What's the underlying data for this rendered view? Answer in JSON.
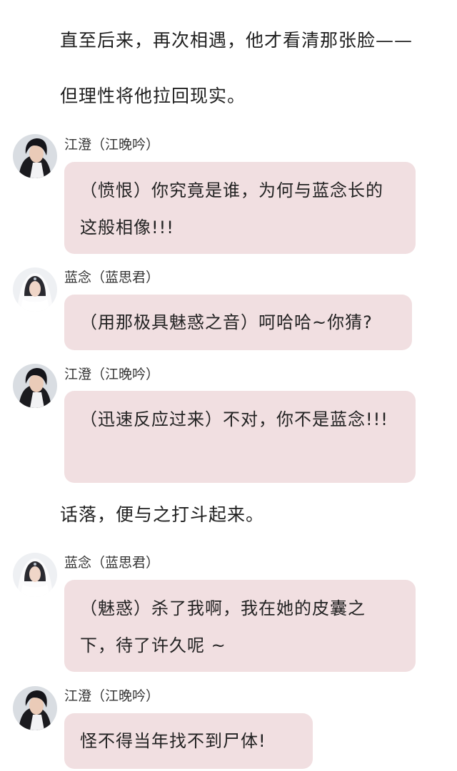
{
  "narration": [
    "直至后来，再次相遇，他才看清那张脸——",
    "但理性将他拉回现实。",
    "话落，便与之打斗起来。"
  ],
  "messages": [
    {
      "speaker": "江澄（江晚吟）",
      "avatar": "dark-haired-man-avatar",
      "text": "（愤恨）你究竟是谁，为何与蓝念长的这般相像!!!"
    },
    {
      "speaker": "蓝念（蓝思君）",
      "avatar": "white-veiled-woman-avatar",
      "text": "（用那极具魅惑之音）呵哈哈~你猜?"
    },
    {
      "speaker": "江澄（江晚吟）",
      "avatar": "dark-haired-man-avatar",
      "text": "（迅速反应过来）不对，你不是蓝念!!!"
    },
    {
      "speaker": "蓝念（蓝思君）",
      "avatar": "white-veiled-woman-avatar",
      "text": "（魅惑）杀了我啊，我在她的皮囊之下，待了许久呢 ~"
    },
    {
      "speaker": "江澄（江晚吟）",
      "avatar": "dark-haired-man-avatar",
      "text": "怪不得当年找不到尸体!"
    }
  ],
  "colors": {
    "bubble": "#f1dfe1",
    "background": "#ffffff",
    "text": "#222222"
  }
}
